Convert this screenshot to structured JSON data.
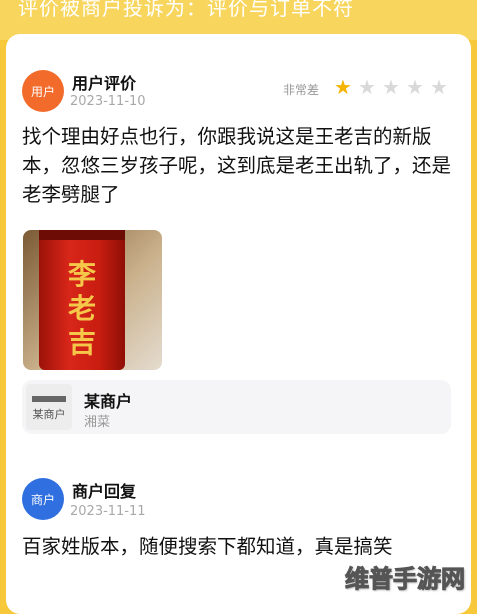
{
  "header": {
    "banner_text": "评价被商户投诉为：评价与订单不符"
  },
  "review": {
    "avatar_text": "用户",
    "name": "用户评价",
    "date": "2023-11-10",
    "rating_text": "非常差",
    "rating": 1,
    "rating_max": 5,
    "text": "找个理由好点也行，你跟我说这是王老吉的新版本，忽悠三岁孩子呢，这到底是老王出轨了，还是老李劈腿了",
    "photo_brand": "李老吉"
  },
  "merchant": {
    "name": "某商户",
    "category": "湘菜",
    "icon_label": "某商户"
  },
  "reply": {
    "avatar_text": "商户",
    "name": "商户回复",
    "date": "2023-11-11",
    "text": "百家姓版本，随便搜索下都知道，真是搞笑"
  },
  "watermark": {
    "text": "维普手游网"
  },
  "colors": {
    "background": "#f6c83a",
    "user_avatar": "#f36b2a",
    "merchant_avatar": "#2f6fe0",
    "star_on": "#f4b400",
    "star_off": "#d9d9d9"
  }
}
